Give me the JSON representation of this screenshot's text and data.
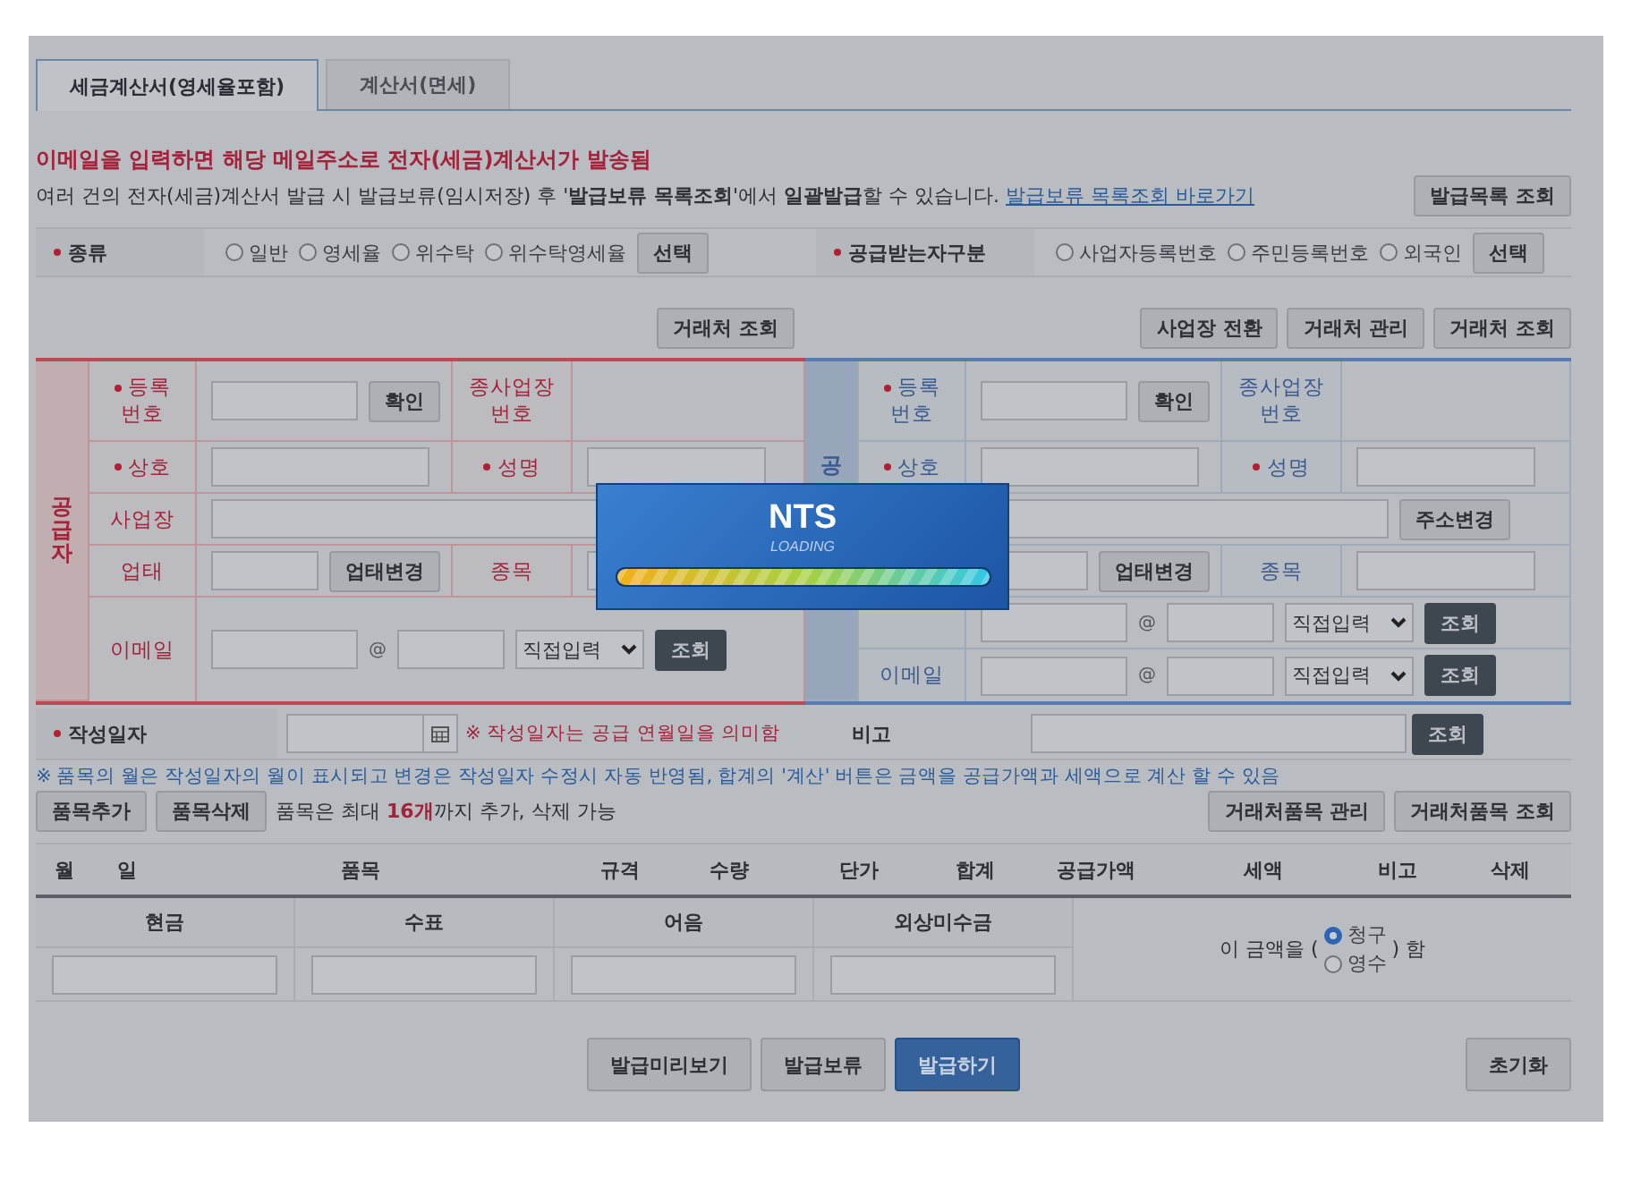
{
  "tabs": [
    {
      "label": "세금계산서(영세율포함)",
      "selected": true
    },
    {
      "label": "계산서(면세)",
      "selected": false
    }
  ],
  "notice": "이메일을 입력하면 해당 메일주소로 전자(세금)계산서가 발송됨",
  "info": {
    "text": "여러 건의 전자(세금)계산서 발급 시 발급보류(임시저장) 후 '**발급보류 목록조회**'에서 **일괄발급**할 수 있습니다.",
    "link": "발급보류 목록조회 바로가기"
  },
  "issue_list_button": "발급목록 조회",
  "kind": {
    "label": "종류",
    "required": true,
    "options": [
      {
        "label": "일반",
        "selected": false
      },
      {
        "label": "영세율",
        "selected": false
      },
      {
        "label": "위수탁",
        "selected": false
      },
      {
        "label": "위수탁영세율",
        "selected": false
      }
    ],
    "button": "선택"
  },
  "recipient_type": {
    "label": "공급받는자구분",
    "required": true,
    "options": [
      {
        "label": "사업자등록번호",
        "selected": false
      },
      {
        "label": "주민등록번호",
        "selected": false
      },
      {
        "label": "외국인",
        "selected": false
      }
    ],
    "button": "선택"
  },
  "left_buttons": [
    "거래처 조회"
  ],
  "right_buttons": [
    "사업장 전환",
    "거래처 관리",
    "거래처 조회"
  ],
  "supplier": {
    "title": "공급자",
    "reg_label": "등록\n번호",
    "reg_required": true,
    "confirm_button": "확인",
    "branch_label": "종사업장\n번호",
    "name_label": "상호",
    "name_required": true,
    "rep_label": "성명",
    "rep_required": true,
    "address_label": "사업장",
    "business_type_label": "업태",
    "business_type_button": "업태변경",
    "item_label": "종목",
    "email_rows": [
      {
        "label": "이메일",
        "at": "@",
        "domain": "직접입력",
        "button": "조회"
      }
    ]
  },
  "buyer": {
    "title": "공",
    "reg_label": "등록\n번호",
    "reg_required": true,
    "confirm_button": "확인",
    "branch_label": "종사업장\n번호",
    "name_label": "상호",
    "name_required": true,
    "rep_label": "성명",
    "rep_required": true,
    "address_button": "주소변경",
    "business_type_button": "업태변경",
    "item_label": "종목",
    "email_rows": [
      {
        "at": "@",
        "domain": "직접입력",
        "button": "조회"
      },
      {
        "label": "이메일",
        "at": "@",
        "domain": "직접입력",
        "button": "조회"
      }
    ]
  },
  "date_row": {
    "label": "작성일자",
    "required": true,
    "note": "※ 작성일자는 공급 연월일을 의미함",
    "remark_label": "비고",
    "button": "조회"
  },
  "item_note": "※ 품목의 월은 작성일자의 월이 표시되고 변경은 작성일자 수정시 자동 반영됨, 합계의 '계산' 버튼은 금액을 공급가액과 세액으로 계산 할 수 있음",
  "item_buttons": [
    "품목추가",
    "품목삭제"
  ],
  "item_limit": "품목은 최대 **16개**까지 추가, 삭제 가능",
  "item_right_buttons": [
    "거래처품목 관리",
    "거래처품목 조회"
  ],
  "item_columns": [
    "월",
    "일",
    "품목",
    "규격",
    "수량",
    "단가",
    "합계",
    "공급가액",
    "세액",
    "비고",
    "삭제"
  ],
  "payment_columns": [
    "현금",
    "수표",
    "어음",
    "외상미수금"
  ],
  "amount": {
    "prefix": "이 금액을 (",
    "options": [
      {
        "label": "청구",
        "selected": true
      },
      {
        "label": "영수",
        "selected": false
      }
    ],
    "suffix": ") 함"
  },
  "bottom_buttons": [
    {
      "label": "발급미리보기",
      "kind": "normal"
    },
    {
      "label": "발급보류",
      "kind": "normal"
    },
    {
      "label": "발급하기",
      "kind": "primary"
    }
  ],
  "reset_button": "초기화",
  "loading": {
    "title": "NTS",
    "subtitle": "LOADING",
    "level": 1
  }
}
